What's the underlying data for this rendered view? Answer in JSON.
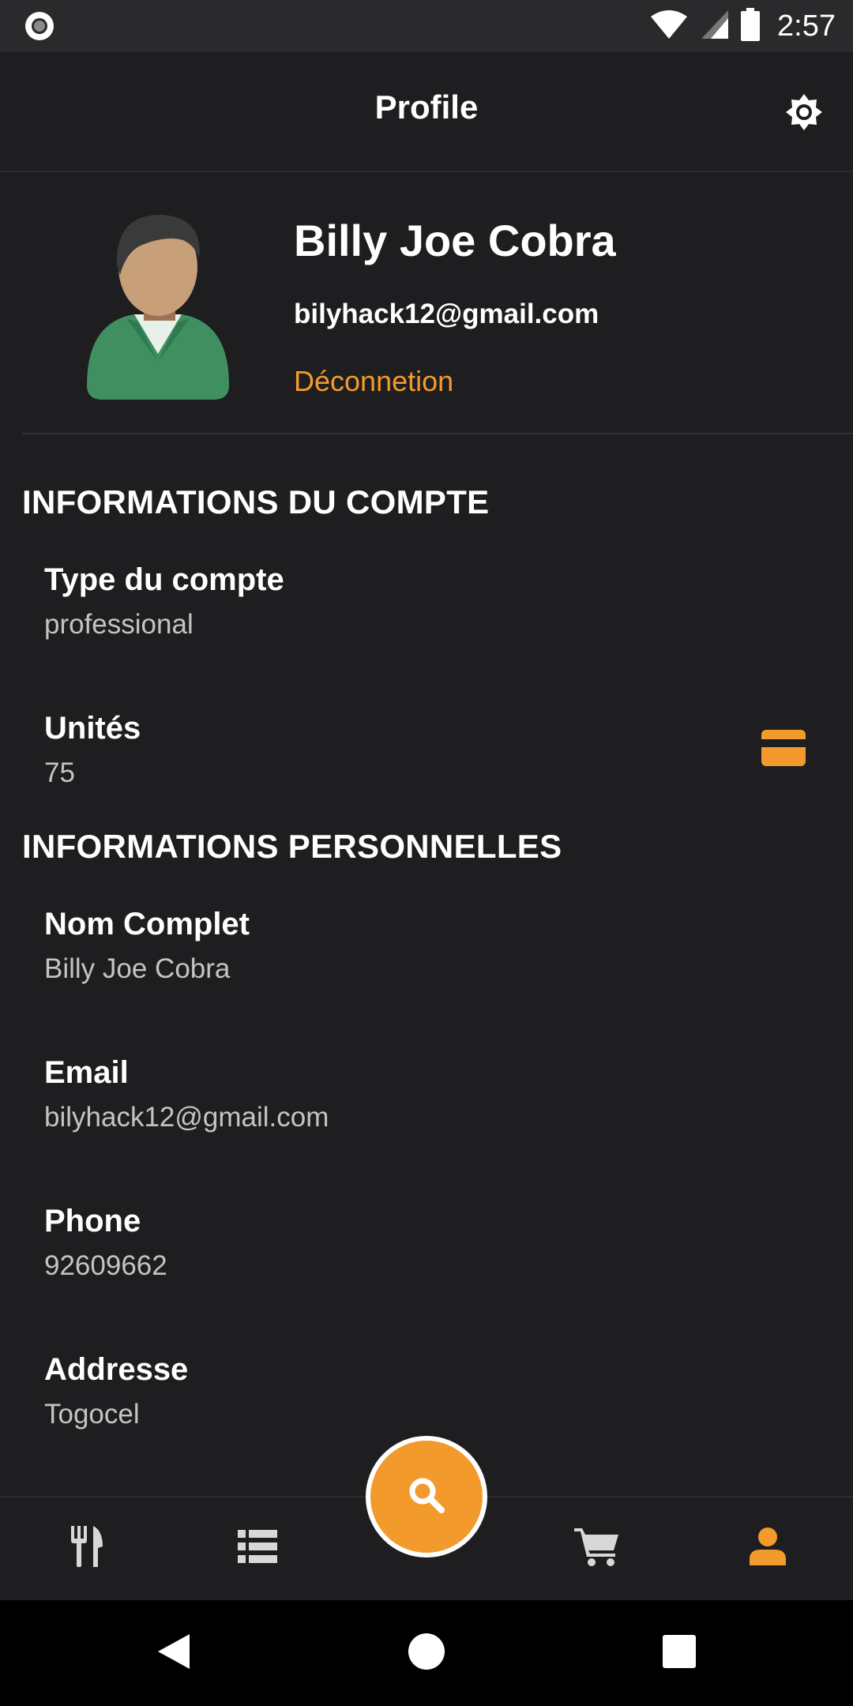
{
  "status_bar": {
    "time": "2:57"
  },
  "app_bar": {
    "title": "Profile"
  },
  "profile": {
    "name": "Billy Joe Cobra",
    "email": "bilyhack12@gmail.com",
    "logout_label": "Déconnetion"
  },
  "account_section": {
    "title": "INFORMATIONS DU COMPTE",
    "fields": [
      {
        "label": "Type du compte",
        "value": "professional"
      },
      {
        "label": "Unités",
        "value": "75"
      }
    ]
  },
  "personal_section": {
    "title": "INFORMATIONS PERSONNELLES",
    "fields": [
      {
        "label": "Nom Complet",
        "value": "Billy Joe Cobra"
      },
      {
        "label": "Email",
        "value": "bilyhack12@gmail.com"
      },
      {
        "label": "Phone",
        "value": "92609662"
      },
      {
        "label": "Addresse",
        "value": "Togocel"
      }
    ]
  },
  "bottom_nav": {
    "items": [
      {
        "icon": "restaurant-icon",
        "active": false
      },
      {
        "icon": "list-icon",
        "active": false
      },
      {
        "icon": "search-icon",
        "active": false
      },
      {
        "icon": "cart-icon",
        "active": false
      },
      {
        "icon": "person-icon",
        "active": true
      }
    ]
  },
  "colors": {
    "background": "#1e1e20",
    "accent": "#f39a2d",
    "text_primary": "#ffffff",
    "text_secondary": "#c4c4c4"
  }
}
